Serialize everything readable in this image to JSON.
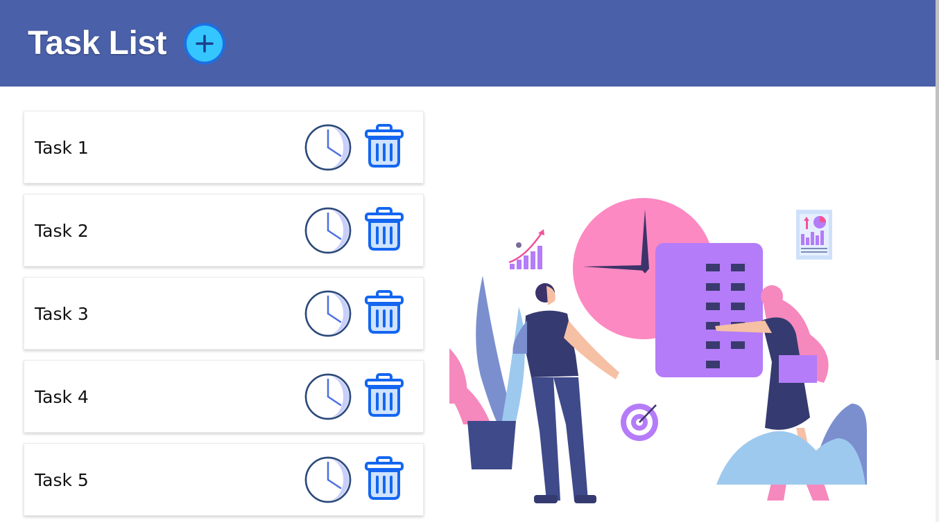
{
  "header": {
    "title": "Task List",
    "add_icon": "plus-circle-icon"
  },
  "tasks": [
    {
      "label": "Task 1"
    },
    {
      "label": "Task 2"
    },
    {
      "label": "Task 3"
    },
    {
      "label": "Task 4"
    },
    {
      "label": "Task 5"
    }
  ],
  "icons": {
    "timer": "clock-icon",
    "delete": "trash-icon"
  },
  "colors": {
    "header_bg": "#4a60a8",
    "accent_blue": "#1e6fe0",
    "add_button_fill": "#35c6ff",
    "clock_stroke": "#2c4a7a",
    "clock_fill": "#c9cffb",
    "trash_blue": "#1466f0"
  }
}
